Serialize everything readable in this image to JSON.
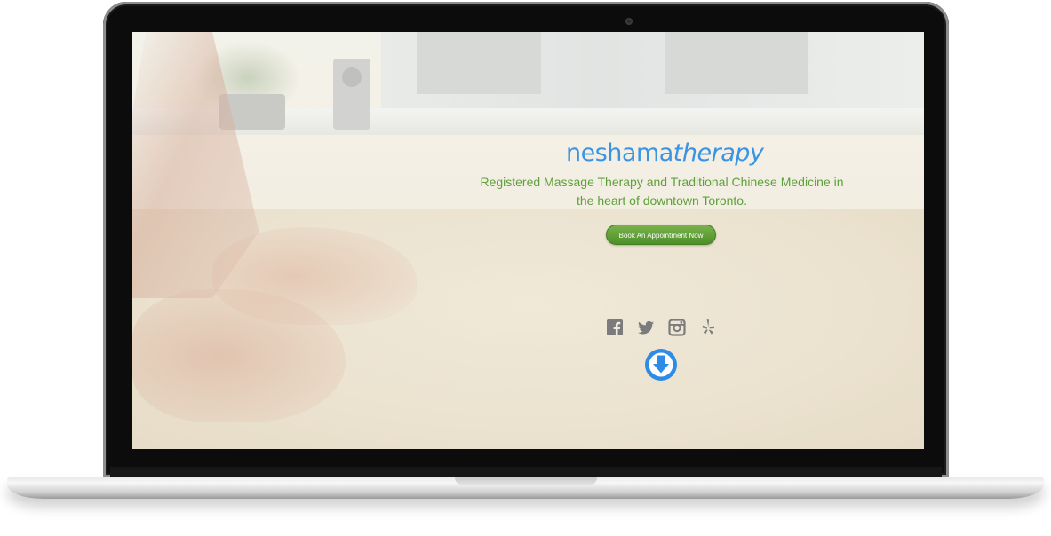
{
  "hero": {
    "brand_primary": "neshama",
    "brand_secondary": "therapy",
    "tagline": "Registered Massage Therapy and Traditional Chinese Medicine in the heart of downtown Toronto.",
    "cta_label": "Book An Appointment Now"
  },
  "social": [
    {
      "icon": "facebook-icon"
    },
    {
      "icon": "twitter-icon"
    },
    {
      "icon": "instagram-icon"
    },
    {
      "icon": "yelp-icon"
    }
  ],
  "scroll": {
    "icon": "arrow-down-circle-icon"
  },
  "colors": {
    "brand_blue": "#3a94e3",
    "tagline_green": "#5da13a",
    "button_green": "#5c9c34",
    "social_gray": "#7b7b7b"
  }
}
